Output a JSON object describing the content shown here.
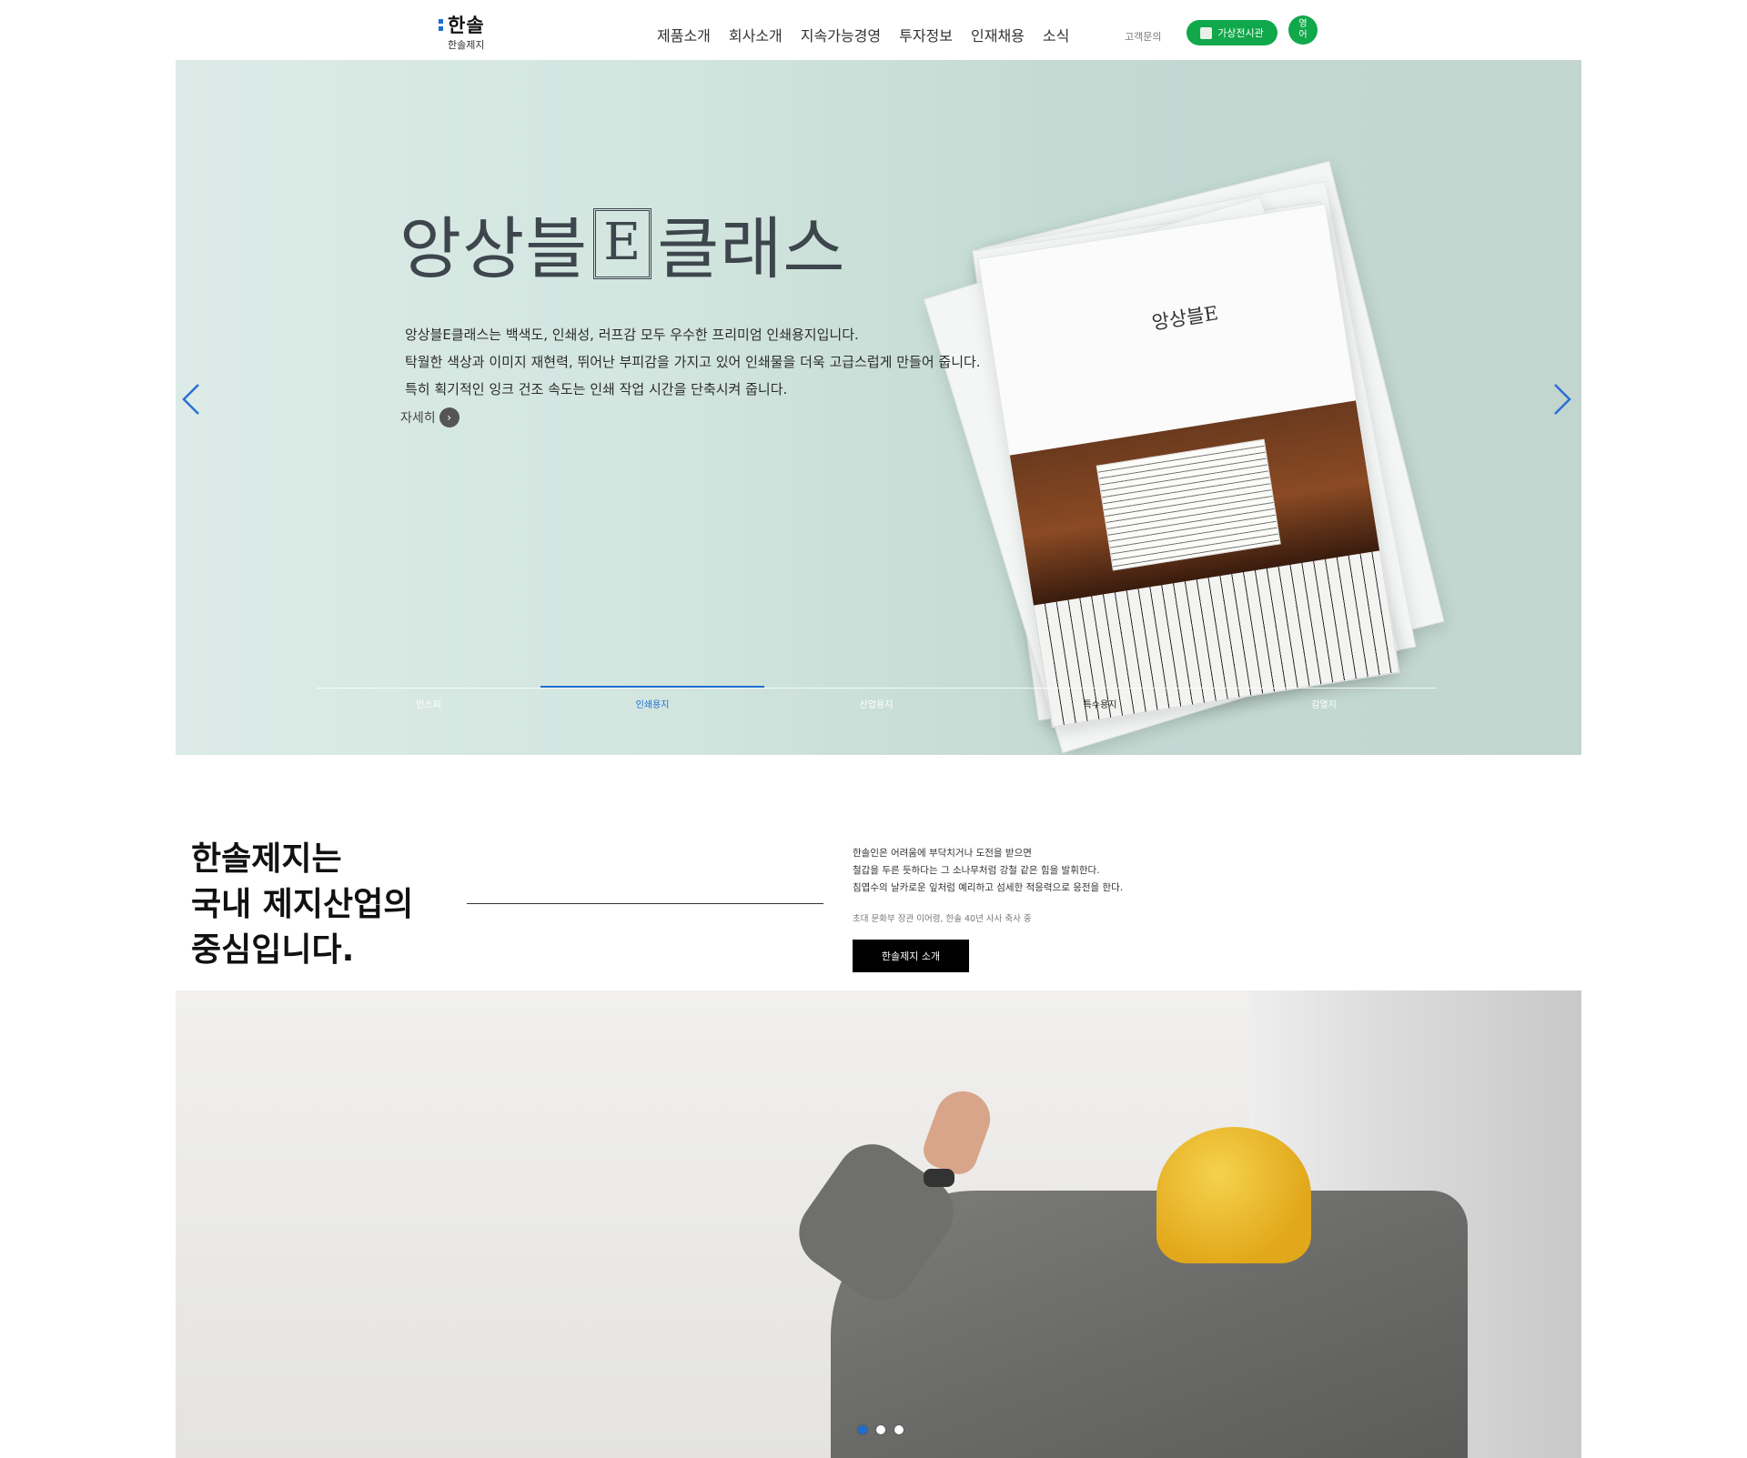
{
  "header": {
    "logo_title": "한솔",
    "logo_sub": "한솔제지",
    "nav": [
      "제품소개",
      "회사소개",
      "지속가능경영",
      "투자정보",
      "인재채용",
      "소식"
    ],
    "inquiry": "고객문의",
    "vr_label": "가상전시관",
    "lang_line1": "영",
    "lang_line2": "어"
  },
  "hero": {
    "title_before": "앙상블",
    "title_e": "E",
    "title_after": "클래스",
    "desc_lines": [
      "앙상블E클래스는 백색도, 인쇄성, 러프감 모두 우수한 프리미엄 인쇄용지입니다.",
      "탁월한 색상과 이미지 재현력, 뛰어난 부피감을 가지고 있어 인쇄물을 더욱 고급스럽게 만들어 줍니다.",
      "특히 획기적인 잉크 건조 속도는 인쇄 작업 시간을 단축시켜 줍니다."
    ],
    "more_label": "자세히",
    "cover_brand": "앙상블E",
    "tabs": [
      "인스피",
      "인쇄용지",
      "산업용지",
      "특수용지",
      "감열지"
    ],
    "active_tab": 1
  },
  "intro": {
    "title_lines": [
      "한솔제지는",
      "국내 제지산업의",
      "중심입니다."
    ],
    "quote_lines": [
      "한솔인은 어려움에 부닥치거나 도전을 받으면",
      "철갑을 두른 듯하다는 그 소나무처럼 강철 같은 힘을 발휘한다.",
      "침엽수의 날카로운 잎처럼 예리하고 섬세한 적응력으로 응전을 한다."
    ],
    "source": "초대 문화부 장관 이어령, 한솔 40년 사사 축사 중",
    "button_label": "한솔제지 소개"
  },
  "photo": {
    "slides": 3,
    "active_slide": 0
  },
  "colors": {
    "brand_green": "#10a84a",
    "accent_blue": "#1c6fd1"
  }
}
